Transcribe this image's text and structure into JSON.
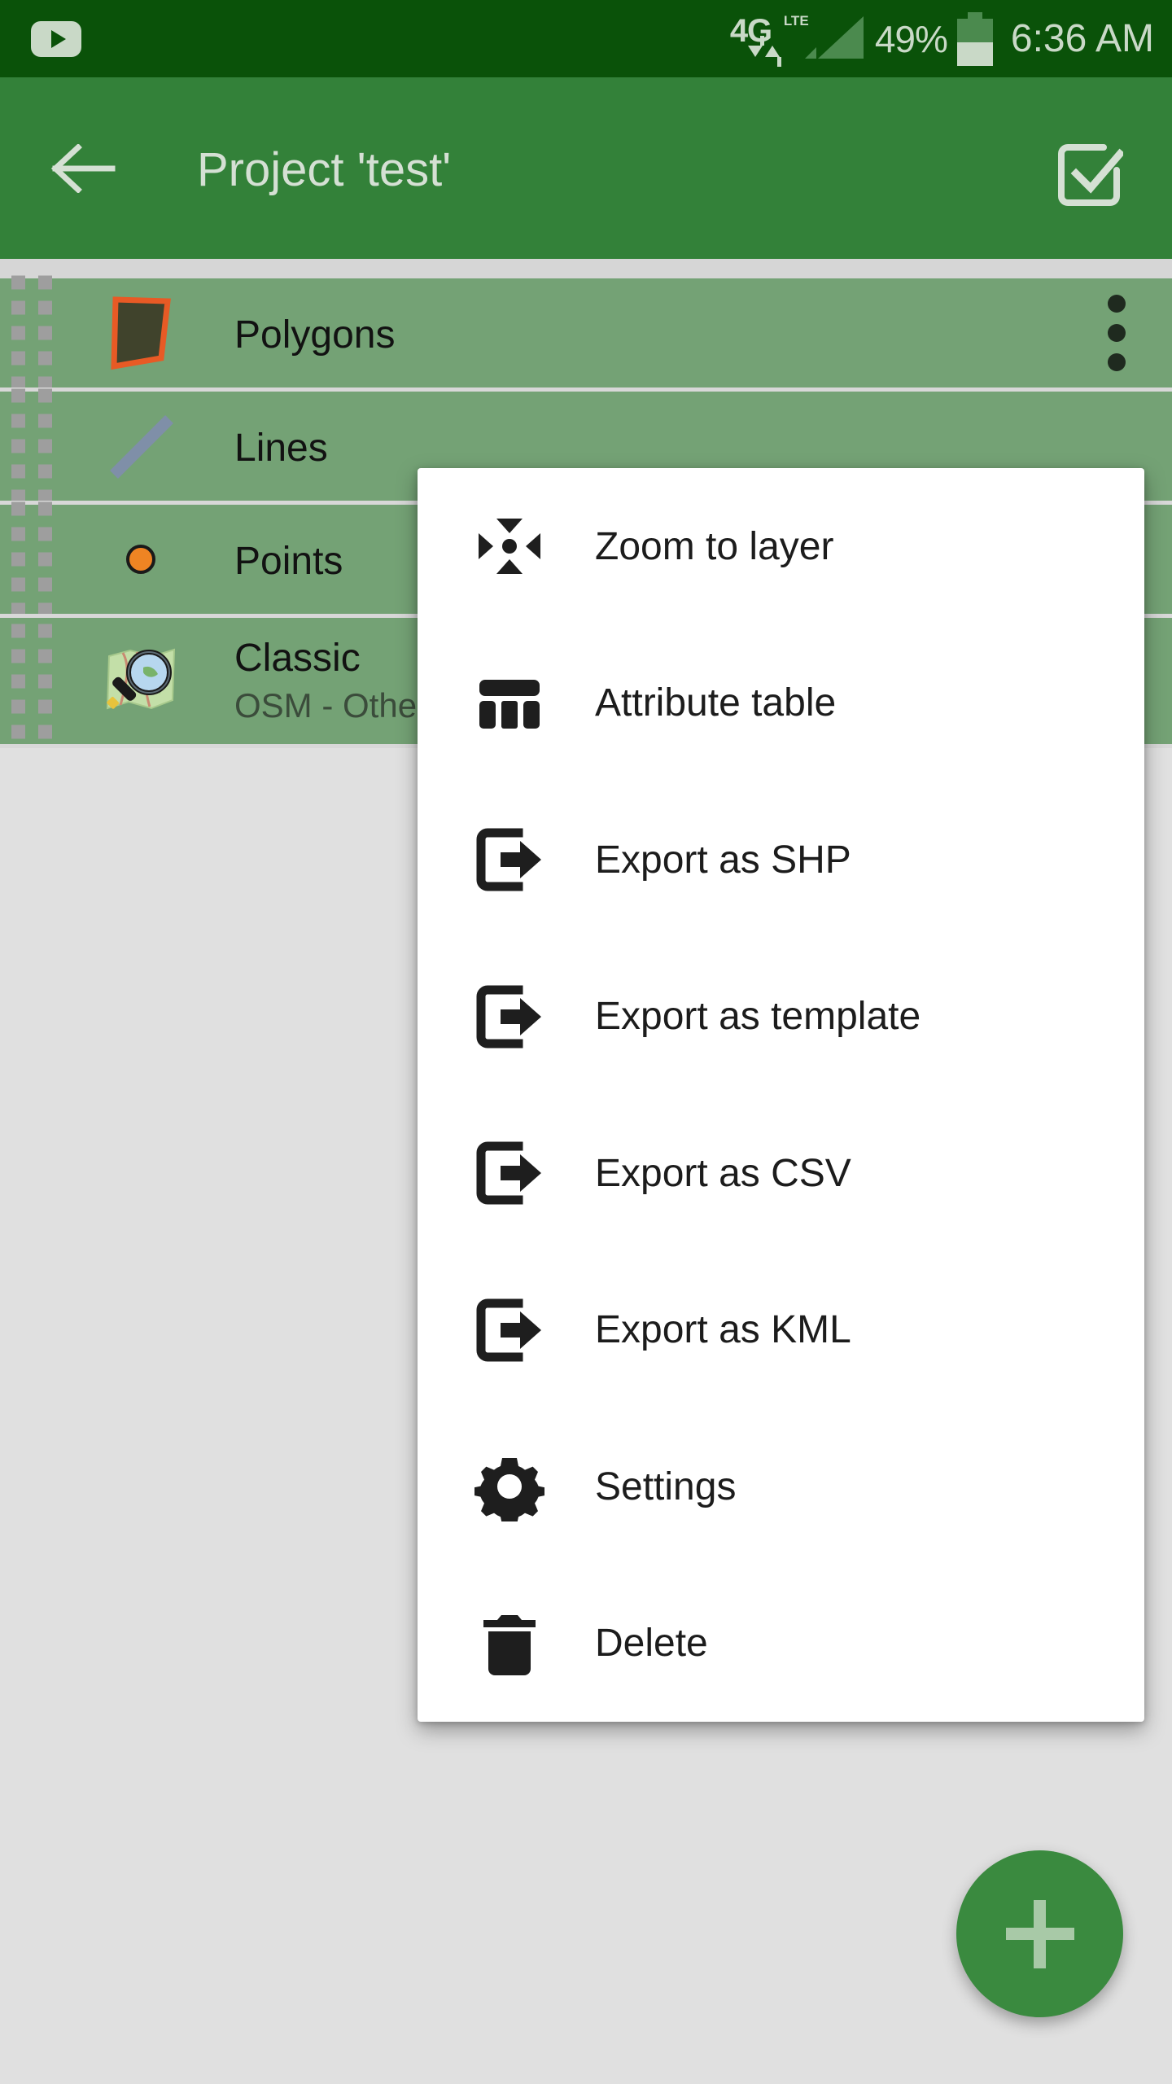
{
  "status_bar": {
    "app_icon": "youtube-icon",
    "network_type": "4G",
    "network_sub": "LTE",
    "data_arrows": "down-up-arrows",
    "signal_icon": "signal-bars-icon",
    "battery_percent": "49%",
    "battery_icon": "battery-icon",
    "clock": "6:36 AM",
    "background_color": "#0a5209",
    "foreground_color": "#c9d9c7"
  },
  "app_bar": {
    "back_label": "back-arrow",
    "title": "Project 'test'",
    "action_label": "select-all-checkbox",
    "background_color": "#338139",
    "foreground_color": "#d5e0d4"
  },
  "layers": {
    "background_color": "#74a275",
    "items": [
      {
        "name": "Polygons",
        "subtitle": "",
        "icon": "polygon-icon",
        "icon_fill": "#40432c",
        "icon_stroke": "#e85a25",
        "has_overflow": true
      },
      {
        "name": "Lines",
        "subtitle": "",
        "icon": "line-icon",
        "icon_fill": "#7f8fa8",
        "icon_stroke": "#7f8fa8",
        "has_overflow": false
      },
      {
        "name": "Points",
        "subtitle": "",
        "icon": "point-icon",
        "icon_fill": "#ef8423",
        "icon_stroke": "#1a1a1a",
        "has_overflow": false
      },
      {
        "name": "Classic",
        "subtitle": "OSM - Other",
        "icon": "map-magnifier-icon",
        "icon_fill": "#b9d6a0",
        "icon_stroke": "#1a1a1a",
        "has_overflow": false
      }
    ]
  },
  "context_menu": {
    "background_color": "#ffffff",
    "items": [
      {
        "label": "Zoom to layer",
        "icon": "zoom-to-layer-icon"
      },
      {
        "label": "Attribute table",
        "icon": "table-icon"
      },
      {
        "label": "Export as SHP",
        "icon": "export-icon"
      },
      {
        "label": "Export as template",
        "icon": "export-icon"
      },
      {
        "label": "Export as CSV",
        "icon": "export-icon"
      },
      {
        "label": "Export as KML",
        "icon": "export-icon"
      },
      {
        "label": "Settings",
        "icon": "gear-icon"
      },
      {
        "label": "Delete",
        "icon": "trash-icon"
      }
    ]
  },
  "fab": {
    "label": "add-layer",
    "icon": "plus-icon",
    "color": "#3a8a3f"
  }
}
